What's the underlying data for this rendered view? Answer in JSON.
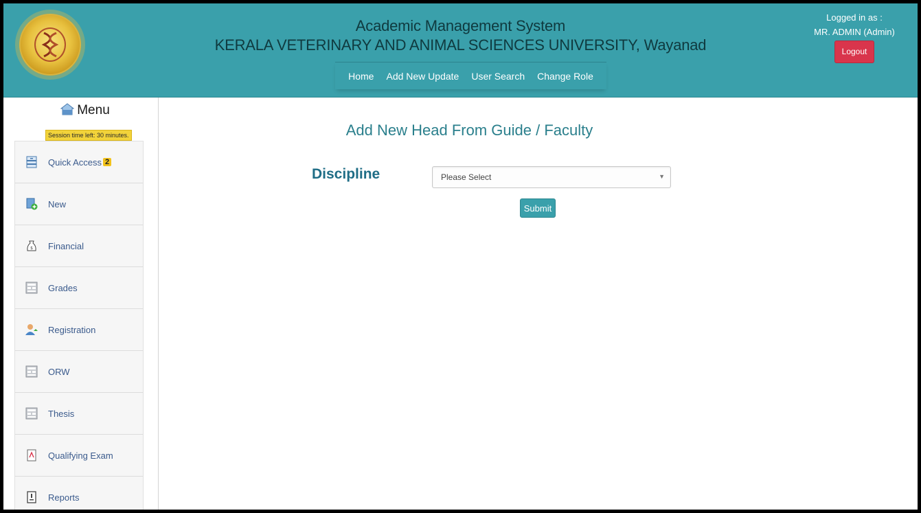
{
  "header": {
    "title_line1": "Academic Management System",
    "title_line2": "KERALA VETERINARY AND ANIMAL SCIENCES UNIVERSITY, Wayanad",
    "nav": [
      "Home",
      "Add New Update",
      "User Search",
      "Change Role"
    ],
    "logged_in_label": "Logged in as :",
    "user": "MR. ADMIN (Admin)",
    "logout_label": "Logout",
    "logo_icon": "university-seal-icon"
  },
  "sidebar": {
    "menu_title": "Menu",
    "session_text": "Session time left: 30 minutes.",
    "items": [
      {
        "label": "Quick Access",
        "badge": "2",
        "icon": "quick-access-icon"
      },
      {
        "label": "New",
        "icon": "new-document-icon"
      },
      {
        "label": "Financial",
        "icon": "money-bag-icon"
      },
      {
        "label": "Grades",
        "icon": "grades-icon"
      },
      {
        "label": "Registration",
        "icon": "registration-user-icon"
      },
      {
        "label": "ORW",
        "icon": "orw-icon"
      },
      {
        "label": "Thesis",
        "icon": "thesis-icon"
      },
      {
        "label": "Qualifying Exam",
        "icon": "exam-document-icon"
      },
      {
        "label": "Reports",
        "icon": "reports-icon"
      }
    ]
  },
  "main": {
    "page_title": "Add New Head From Guide / Faculty",
    "discipline_label": "Discipline",
    "discipline_select_value": "Please Select",
    "submit_label": "Submit"
  },
  "colors": {
    "header_bg": "#3aa0ab",
    "logout_bg": "#d9354c",
    "session_bg": "#f2d33a",
    "title_color": "#2a7f8c",
    "label_color": "#1f6d86"
  }
}
